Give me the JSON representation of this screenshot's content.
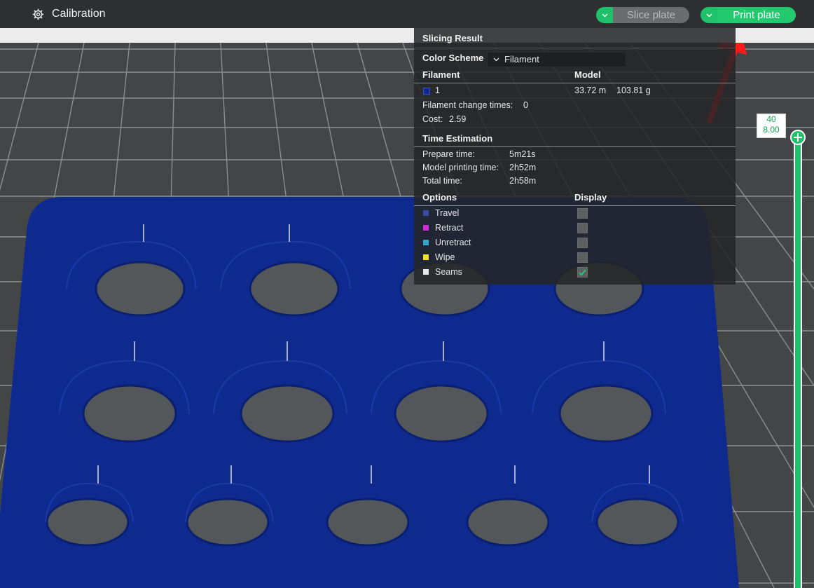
{
  "topbar": {
    "calibration_label": "Calibration",
    "slice_button": "Slice plate",
    "print_button": "Print plate",
    "accent_color": "#22c96f"
  },
  "slicing_panel": {
    "title": "Slicing Result",
    "color_scheme_label": "Color Scheme",
    "color_scheme_value": "Filament",
    "filament_header": "Filament",
    "model_header": "Model",
    "filament": {
      "id": "1",
      "color": "#0f2a8f",
      "length": "33.72 m",
      "weight": "103.81 g"
    },
    "filament_change_label": "Filament change times:",
    "filament_change_value": "0",
    "cost_label": "Cost:",
    "cost_value": "2.59",
    "time_header": "Time Estimation",
    "times": [
      {
        "label": "Prepare time:",
        "value": "5m21s"
      },
      {
        "label": "Model printing time:",
        "value": "2h52m"
      },
      {
        "label": "Total time:",
        "value": "2h58m"
      }
    ],
    "options_header": "Options",
    "display_header": "Display",
    "options": [
      {
        "label": "Travel",
        "color": "#3b4aa8",
        "checked": false
      },
      {
        "label": "Retract",
        "color": "#d12bd6",
        "checked": false
      },
      {
        "label": "Unretract",
        "color": "#3aa6cf",
        "checked": false
      },
      {
        "label": "Wipe",
        "color": "#f2e21a",
        "checked": false
      },
      {
        "label": "Seams",
        "color": "#e8e8e8",
        "checked": true
      }
    ]
  },
  "layer_slider": {
    "layer": "40",
    "height": "8.00"
  }
}
